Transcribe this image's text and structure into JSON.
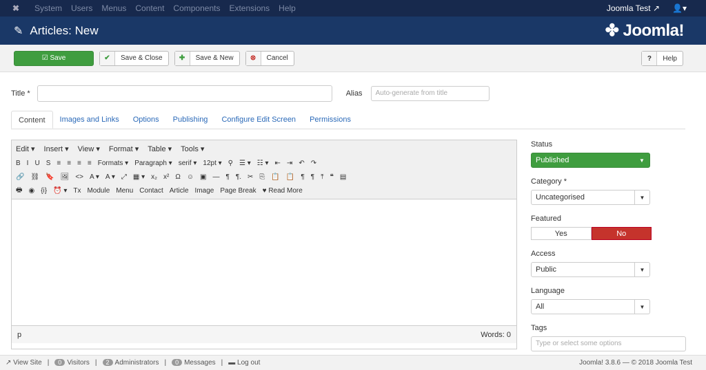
{
  "topnav": {
    "items": [
      "System",
      "Users",
      "Menus",
      "Content",
      "Components",
      "Extensions",
      "Help"
    ],
    "user": "Joomla Test ↗",
    "profile_icon": "user-icon"
  },
  "header": {
    "title": "Articles: New",
    "brand": "Joomla!"
  },
  "toolbar": {
    "save": "Save",
    "save_close": "Save & Close",
    "save_new": "Save & New",
    "cancel": "Cancel",
    "help": "Help"
  },
  "form": {
    "title_label": "Title *",
    "title_value": "",
    "alias_label": "Alias",
    "alias_placeholder": "Auto-generate from title"
  },
  "tabs": [
    "Content",
    "Images and Links",
    "Options",
    "Publishing",
    "Configure Edit Screen",
    "Permissions"
  ],
  "editor": {
    "menus": [
      "Edit ▾",
      "Insert ▾",
      "View ▾",
      "Format ▾",
      "Table ▾",
      "Tools ▾"
    ],
    "row1": [
      "B",
      "I",
      "U",
      "S",
      "≡",
      "≡",
      "≡",
      "≡",
      "Formats ▾",
      "Paragraph ▾",
      "serif ▾",
      "12pt ▾",
      "⚲",
      "☰ ▾",
      "☷ ▾",
      "⇤",
      "⇥",
      "↶",
      "↷"
    ],
    "row2": [
      "🔗",
      "⛓",
      "🔖",
      "🖼",
      "<>",
      "A ▾",
      "A ▾",
      "⤢",
      "▦ ▾",
      "x₂",
      "x²",
      "Ω",
      "☺",
      "▣",
      "—",
      "¶",
      "¶.",
      "✂",
      "⎘",
      "📋",
      "📋",
      "¶",
      "¶",
      "⤒",
      "❝",
      "▤"
    ],
    "row3": [
      "🖶",
      "◉",
      "{i}",
      "⏰ ▾",
      "Tx",
      "Module",
      "Menu",
      "Contact",
      "Article",
      "Image",
      "Page Break",
      "♥ Read More"
    ],
    "path": "p",
    "words": "Words: 0"
  },
  "sidebar": {
    "status_label": "Status",
    "status": "Published",
    "category_label": "Category *",
    "category": "Uncategorised",
    "featured_label": "Featured",
    "yes": "Yes",
    "no": "No",
    "access_label": "Access",
    "access": "Public",
    "language_label": "Language",
    "language": "All",
    "tags_label": "Tags",
    "tags_placeholder": "Type or select some options"
  },
  "footer": {
    "view_site": "View Site",
    "visitors_count": "0",
    "visitors": "Visitors",
    "admins_count": "2",
    "admins": "Administrators",
    "messages_count": "0",
    "messages": "Messages",
    "logout": "Log out",
    "copyright": "Joomla! 3.8.6 — © 2018 Joomla Test"
  },
  "colors": {
    "nav": "#17294d",
    "header": "#1a3867",
    "green": "#3f9d3f",
    "red": "#c5332c"
  }
}
